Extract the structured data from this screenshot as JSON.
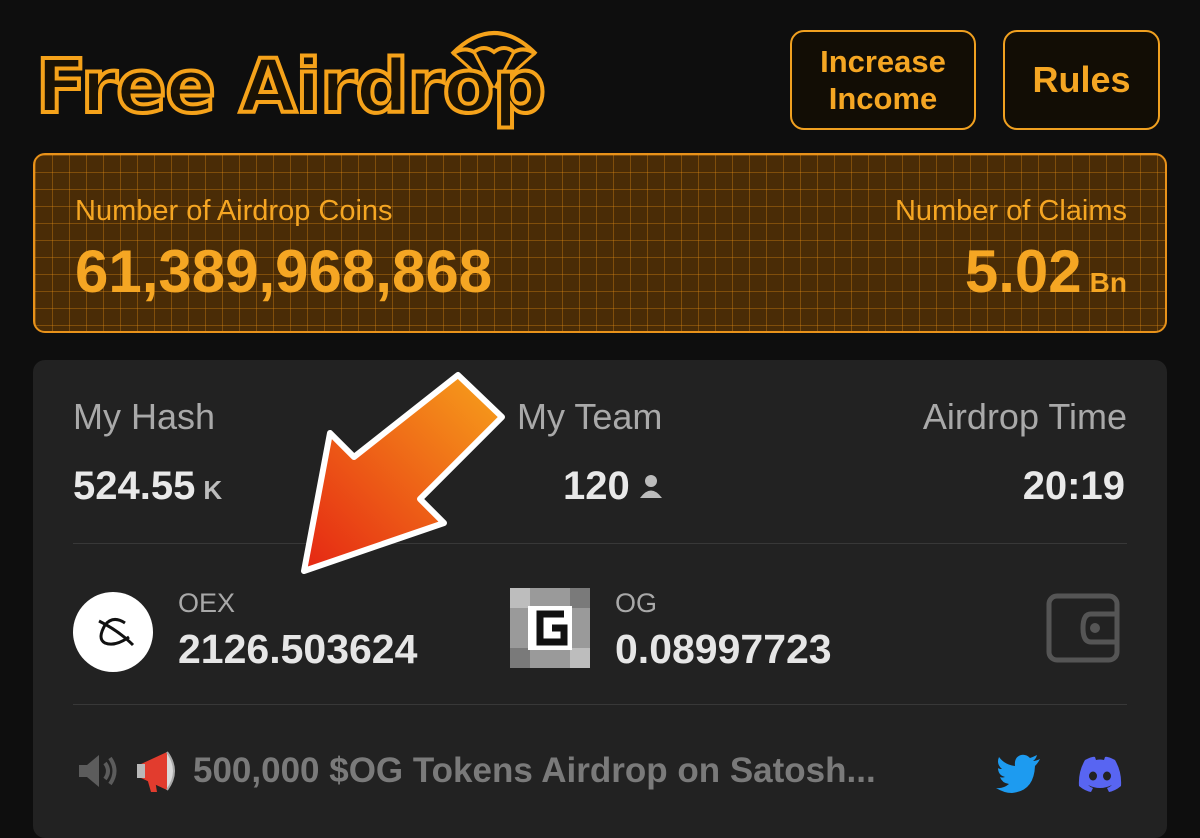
{
  "header": {
    "logo_text": "Free Airdrop",
    "increase_label_line1": "Increase",
    "increase_label_line2": "Income",
    "rules_label": "Rules"
  },
  "stats": {
    "airdrop_coins_label": "Number of Airdrop Coins",
    "airdrop_coins_value": "61,389,968,868",
    "claims_label": "Number of Claims",
    "claims_value": "5.02",
    "claims_unit": "Bn"
  },
  "metrics": {
    "hash_label": "My Hash",
    "hash_value": "524.55",
    "hash_unit": "K",
    "team_label": "My Team",
    "team_value": "120",
    "time_label": "Airdrop Time",
    "time_value": "20:19"
  },
  "coins": [
    {
      "name": "OEX",
      "amount": "2126.503624",
      "icon": "oex-logo-icon"
    },
    {
      "name": "OG",
      "amount": "0.08997723",
      "icon": "og-logo-icon"
    }
  ],
  "notice": {
    "text": "500,000 $OG Tokens Airdrop on Satosh..."
  },
  "colors": {
    "accent": "#f5a623",
    "background": "#0e0e0e",
    "card": "#222222",
    "twitter": "#1d9bf0",
    "discord": "#5865f2",
    "arrow_start": "#f7a21b",
    "arrow_end": "#e52613"
  },
  "icons": [
    "parachute-icon",
    "person-icon",
    "wallet-icon",
    "speaker-icon",
    "megaphone-icon",
    "twitter-icon",
    "discord-icon",
    "arrow-annotation"
  ]
}
